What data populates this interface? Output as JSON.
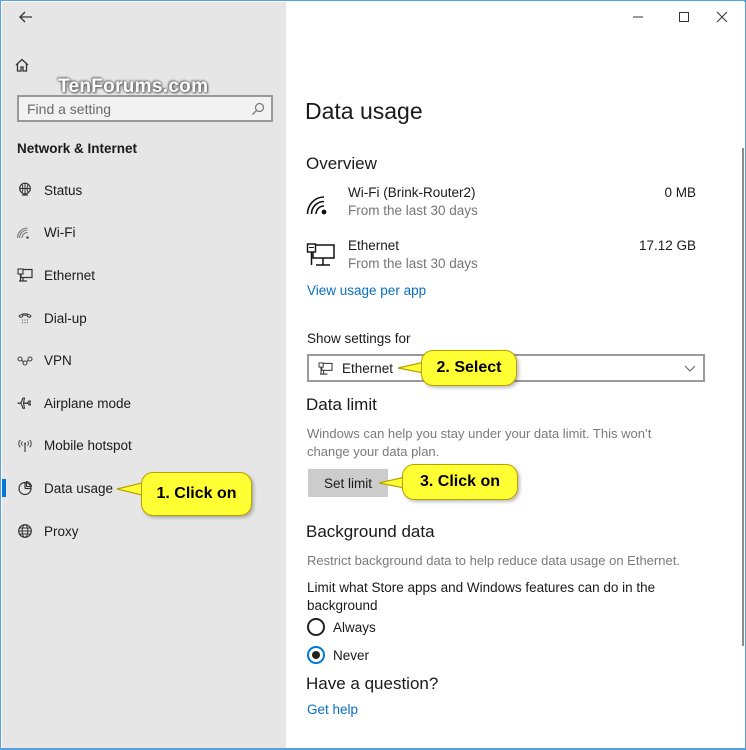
{
  "window": {
    "back_label": "Back",
    "controls": {
      "minimize": "minimize-icon",
      "maximize": "maximize-icon",
      "close": "close-icon"
    }
  },
  "watermark": "TenForums.com",
  "sidebar": {
    "home_icon": "home-icon",
    "search": {
      "placeholder": "Find a setting",
      "value": ""
    },
    "section_title": "Network & Internet",
    "items": [
      {
        "label": "Status",
        "icon": "globe-monitor-icon",
        "active": false
      },
      {
        "label": "Wi-Fi",
        "icon": "wifi-icon",
        "active": false
      },
      {
        "label": "Ethernet",
        "icon": "ethernet-icon",
        "active": false
      },
      {
        "label": "Dial-up",
        "icon": "dialup-phone-icon",
        "active": false
      },
      {
        "label": "VPN",
        "icon": "vpn-icon",
        "active": false
      },
      {
        "label": "Airplane mode",
        "icon": "airplane-icon",
        "active": false
      },
      {
        "label": "Mobile hotspot",
        "icon": "hotspot-icon",
        "active": false
      },
      {
        "label": "Data usage",
        "icon": "data-usage-icon",
        "active": true
      },
      {
        "label": "Proxy",
        "icon": "globe-icon",
        "active": false
      }
    ]
  },
  "main": {
    "title": "Data usage",
    "overview": {
      "heading": "Overview",
      "rows": [
        {
          "name": "Wi-Fi (Brink-Router2)",
          "sub": "From the last 30 days",
          "value": "0 MB",
          "icon": "wifi-icon"
        },
        {
          "name": "Ethernet",
          "sub": "From the last 30 days",
          "value": "17.12 GB",
          "icon": "ethernet-icon"
        }
      ],
      "link": "View usage per app"
    },
    "show_settings": {
      "label": "Show settings for",
      "selected": "Ethernet"
    },
    "data_limit": {
      "heading": "Data limit",
      "desc_line1": "Windows can help you stay under your data limit. This won’t",
      "desc_line2": "change your data plan.",
      "button": "Set limit"
    },
    "background_data": {
      "heading": "Background data",
      "desc": "Restrict background data to help reduce data usage on Ethernet.",
      "question_line1": "Limit what Store apps and Windows features can do in the",
      "question_line2": "background",
      "options": [
        {
          "label": "Always",
          "checked": false
        },
        {
          "label": "Never",
          "checked": true
        }
      ]
    },
    "help": {
      "heading": "Have a question?",
      "link": "Get help"
    }
  },
  "callouts": [
    {
      "text": "1. Click on"
    },
    {
      "text": "2. Select"
    },
    {
      "text": "3. Click on"
    }
  ],
  "colors": {
    "accent": "#0078d7",
    "link": "#0a6fc2",
    "sidebar_bg": "#e6e6e6",
    "callout_fill": "#ffff33",
    "callout_border": "#b8a000"
  }
}
